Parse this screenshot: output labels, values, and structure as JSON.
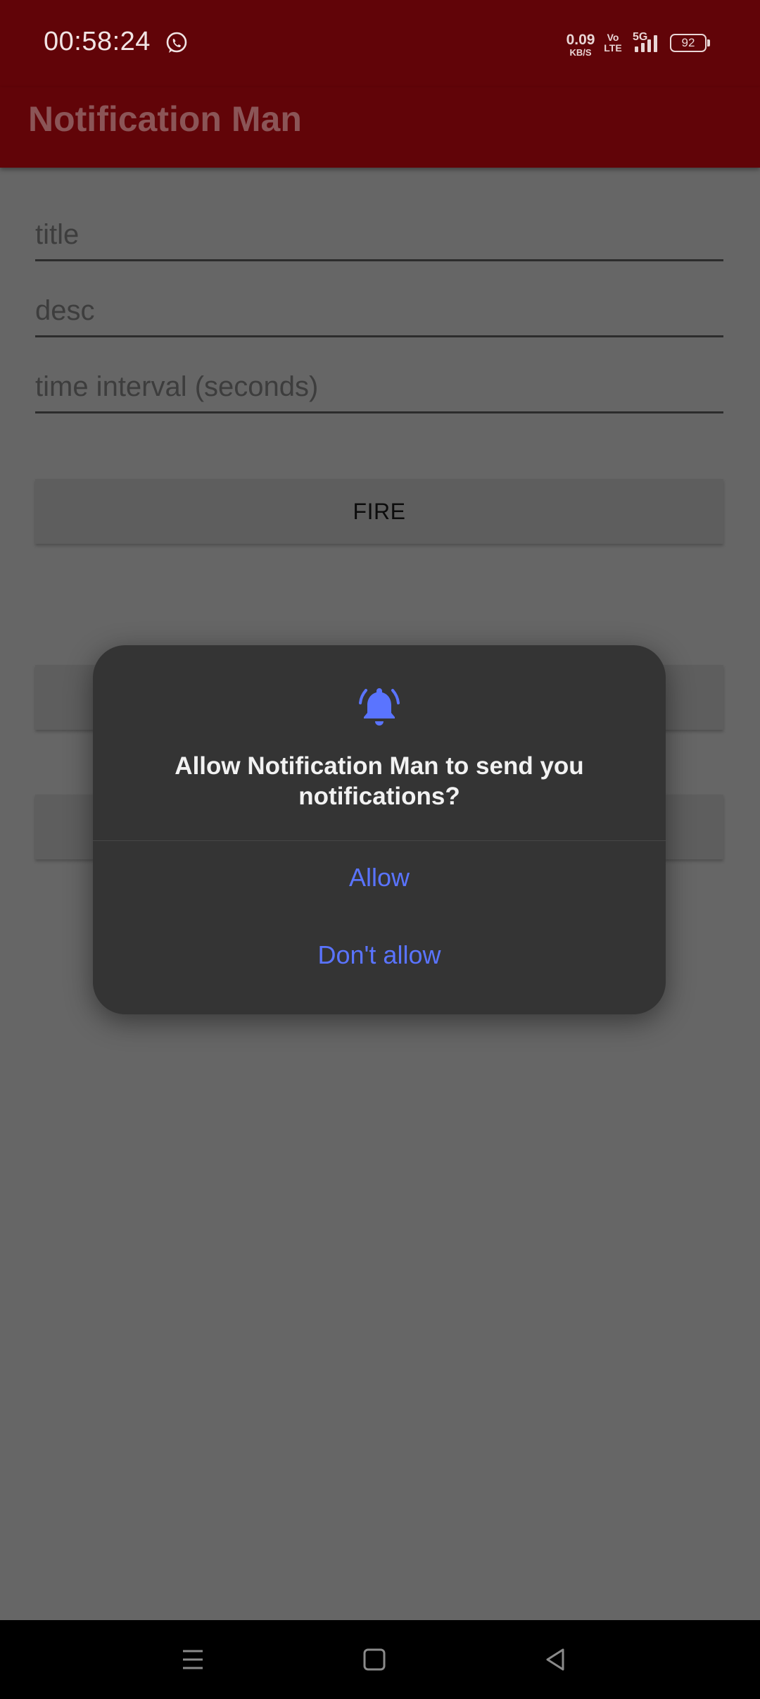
{
  "status_bar": {
    "time": "00:58:24",
    "net_speed_value": "0.09",
    "net_speed_unit": "KB/S",
    "volte_top": "Vo",
    "volte_bottom": "LTE",
    "network_type": "5G",
    "battery_level": "92"
  },
  "app_bar": {
    "title": "Notification Man"
  },
  "form": {
    "title_placeholder": "title",
    "desc_placeholder": "desc",
    "interval_placeholder": "time interval (seconds)",
    "fire_label": "FIRE"
  },
  "dialog": {
    "message": "Allow Notification Man to send you notifications?",
    "allow_label": "Allow",
    "deny_label": "Don't allow",
    "icon": "bell-ringing-icon"
  },
  "colors": {
    "app_bar": "#610408",
    "scrim_background": "#666666",
    "dialog_background": "#343434",
    "dialog_accent": "#5a74ff"
  },
  "nav_bar": {
    "icons": [
      "menu-icon",
      "home-icon",
      "back-icon"
    ]
  }
}
